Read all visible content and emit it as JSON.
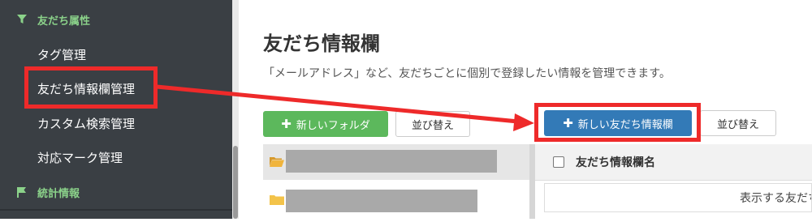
{
  "sidebar": {
    "section_friend_attrs": "友だち属性",
    "items": [
      {
        "label": "タグ管理"
      },
      {
        "label": "友だち情報欄管理"
      },
      {
        "label": "カスタム検索管理"
      },
      {
        "label": "対応マーク管理"
      }
    ],
    "section_stats": "統計情報",
    "icons": {
      "filter": "filter-icon",
      "flag": "flag-icon"
    }
  },
  "main": {
    "title": "友だち情報欄",
    "description": "「メールアドレス」など、友だちごとに個別で登録したい情報を管理できます。",
    "new_folder_label": "新しいフォルダ",
    "sort_label_left": "並び替え",
    "new_field_label": "新しい友だち情報欄",
    "sort_label_right": "並び替え",
    "table_header": "友だち情報欄名",
    "empty_message": "表示する友だち"
  },
  "colors": {
    "sidebar_bg": "#3a3f44",
    "section_green": "#8bd28a",
    "btn_green": "#5cb85c",
    "btn_blue": "#337ab7",
    "annotation_red": "#ee2a2a"
  }
}
